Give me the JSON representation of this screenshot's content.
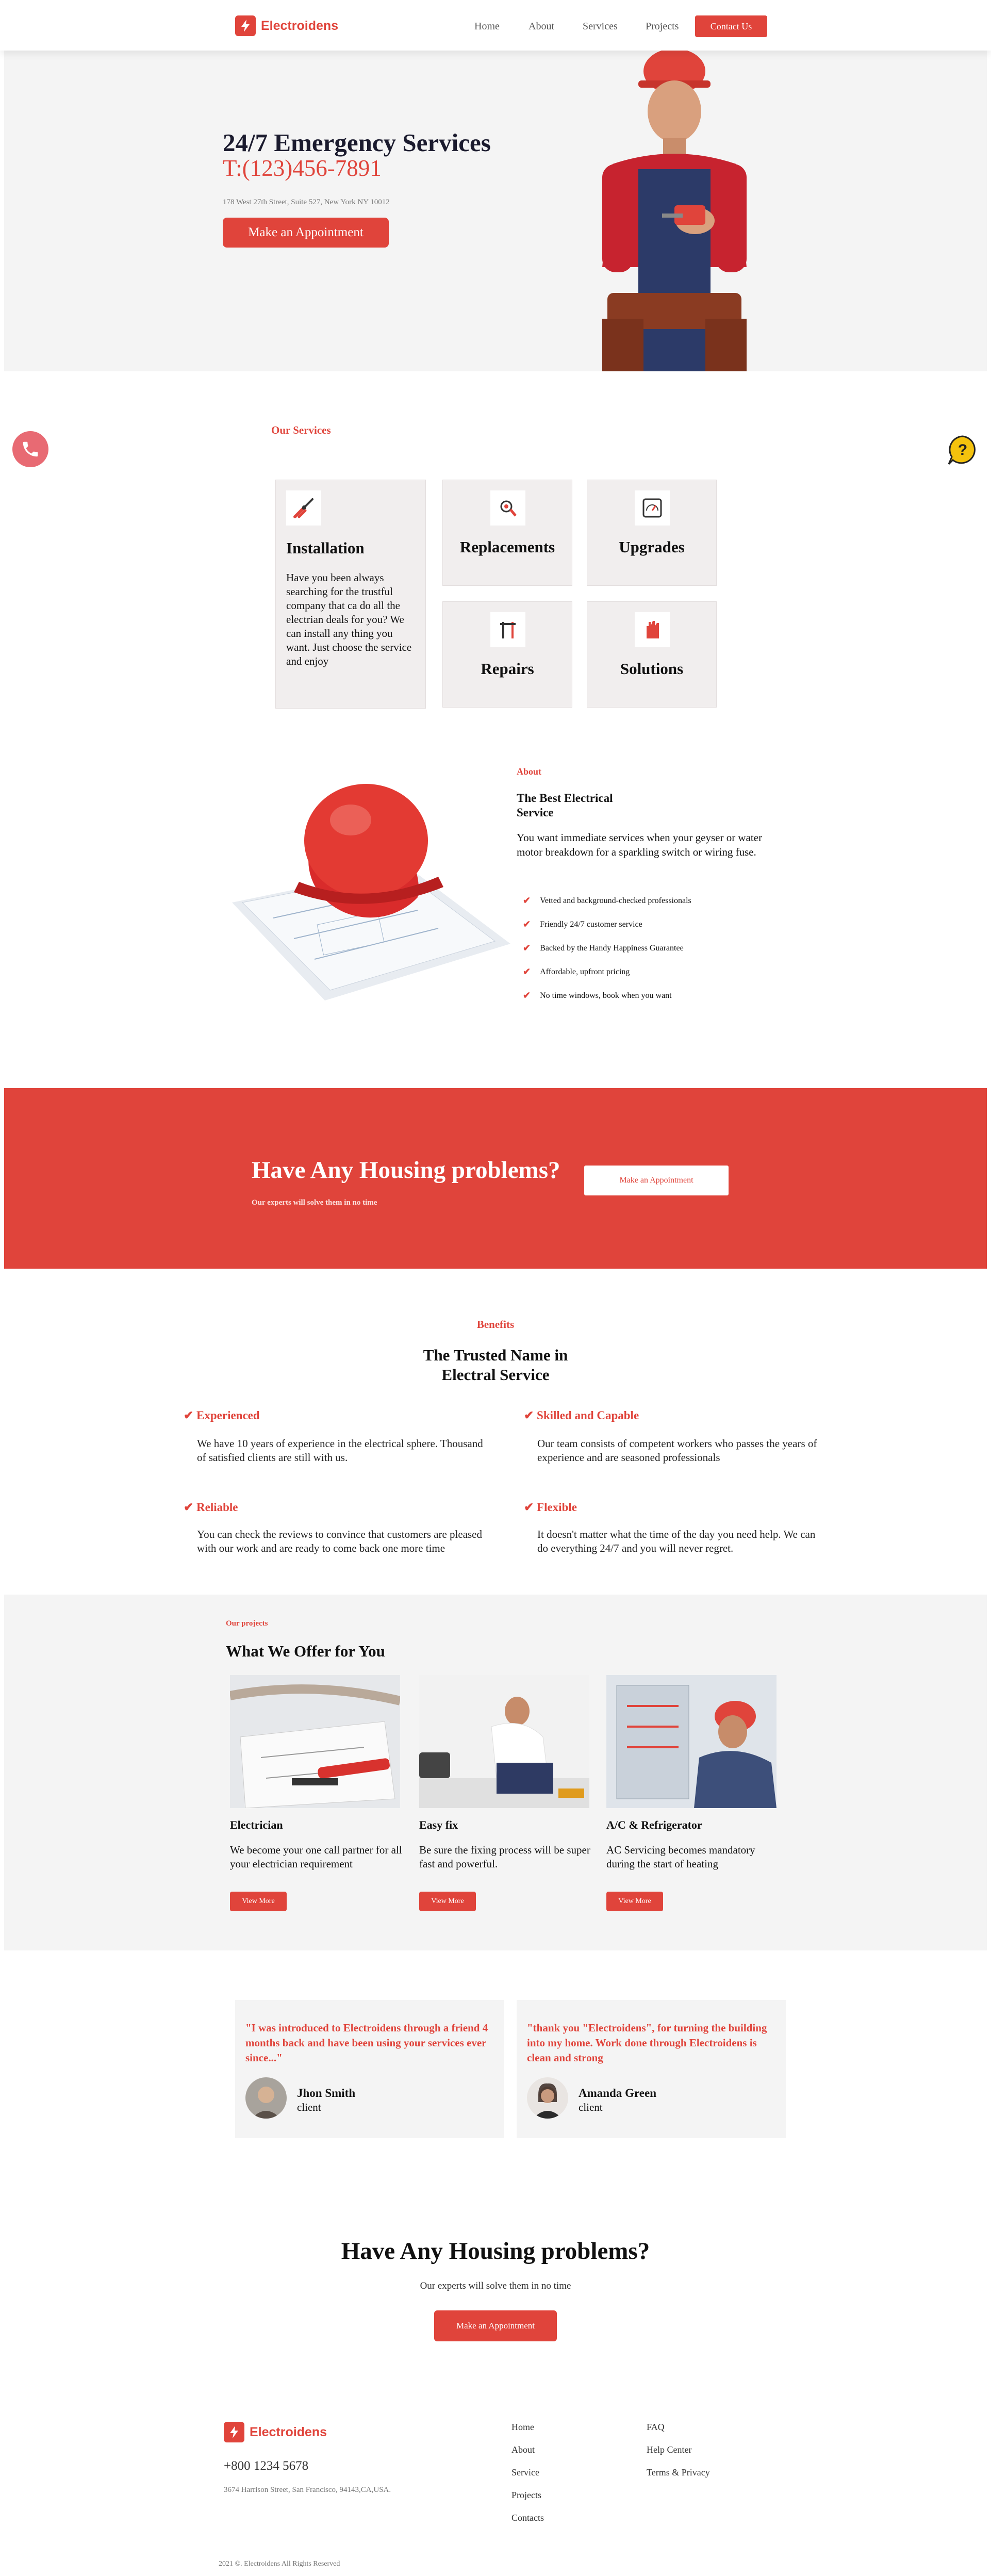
{
  "brand": {
    "name": "Electroidens",
    "color": "#e0443b"
  },
  "nav": {
    "links": [
      "Home",
      "About",
      "Services",
      "Projects"
    ],
    "cta": "Contact Us"
  },
  "hero": {
    "title": "24/7 Emergency Services",
    "phone": "T:(123)456-7891",
    "address": "178 West 27th Street, Suite 527, New York NY 10012",
    "button": "Make an Appointment"
  },
  "services": {
    "label": "Our Services",
    "cards": [
      {
        "title": "Installation",
        "icon": "pliers-icon",
        "text": "Have you been always searching for the trustful company that ca do all the electrian deals for you? We can install any thing you want. Just choose the service and enjoy"
      },
      {
        "title": "Replacements",
        "icon": "cable-icon"
      },
      {
        "title": "Upgrades",
        "icon": "meter-icon"
      },
      {
        "title": "Repairs",
        "icon": "tools-icon"
      },
      {
        "title": "Solutions",
        "icon": "glove-icon"
      }
    ]
  },
  "about": {
    "label": "About",
    "title": "The Best Electrical Service",
    "text": "You want immediate services when your geyser or water motor breakdown for a sparkling switch or wiring fuse.",
    "checks": [
      "Vetted and background-checked professionals",
      "Friendly 24/7 customer service",
      "Backed by the Handy Happiness Guarantee",
      "Affordable, upfront pricing",
      "No time windows, book when you want"
    ]
  },
  "banner": {
    "title": "Have Any Housing problems?",
    "subtitle": "Our experts will solve them in no time",
    "button": "Make an Appointment"
  },
  "benefits": {
    "label": "Benefits",
    "title_line1": "The Trusted Name in",
    "title_line2": "Electral Service",
    "items": [
      {
        "title": "Experienced",
        "text": "We have 10 years of experience in the electrical sphere. Thousand of satisfied clients are still with us."
      },
      {
        "title": "Skilled and Capable",
        "text": "Our team consists of competent workers who passes the years of experience and are seasoned professionals"
      },
      {
        "title": "Reliable",
        "text": "You can check the reviews to convince that customers are pleased with our work and are ready to come back one more time"
      },
      {
        "title": "Flexible",
        "text": "It doesn't matter what the time of the day you need help. We can do everything 24/7 and you will never regret."
      }
    ]
  },
  "projects": {
    "label": "Our projects",
    "title": "What We Offer for You",
    "items": [
      {
        "title": "Electrician",
        "text": "We become your one call partner for all your electrician requirement",
        "button": "View More"
      },
      {
        "title": "Easy fix",
        "text": "Be sure the fixing process will be super fast and powerful.",
        "button": "View More"
      },
      {
        "title": "A/C & Refrigerator",
        "text": "AC Servicing becomes mandatory during the start of heating",
        "button": "View More"
      }
    ]
  },
  "testimonials": [
    {
      "quote": "\"I was introduced to Electroidens through a friend 4 months back and have been using your services ever since...\"",
      "name": "Jhon Smith",
      "role": "client"
    },
    {
      "quote": "\"thank you \"Electroidens\", for turning the building into my home. Work done through Electroidens is clean and strong",
      "name": "Amanda Green",
      "role": "client"
    }
  ],
  "cta": {
    "title": "Have Any Housing problems?",
    "subtitle": "Our experts will solve them in no time",
    "button": "Make an Appointment"
  },
  "footer": {
    "phone": "+800 1234 5678",
    "address": "3674 Harrison Street, San Francisco, 94143,CA,USA.",
    "col1": [
      "Home",
      "About",
      "Service",
      "Projects",
      "Contacts"
    ],
    "col2": [
      "FAQ",
      "Help Center",
      "Terms & Privacy"
    ],
    "copyright": "2021 ©. Electroidens All Rights Reserved"
  }
}
